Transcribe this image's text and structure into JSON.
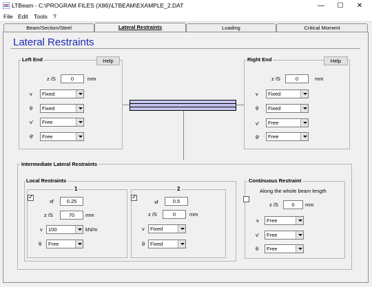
{
  "window": {
    "title": "LTBeam - C:\\PROGRAM FILES (X86)\\LTBEAM\\EXAMPLE_2.DAT",
    "minimize_label": "—",
    "maximize_label": "☐",
    "close_label": "✕"
  },
  "menu": {
    "file": "File",
    "edit": "Edit",
    "tools": "Tools",
    "help": "?"
  },
  "tabs": [
    {
      "label": "Beam/Section/Steel"
    },
    {
      "label": "Lateral Restraints"
    },
    {
      "label": "Loading"
    },
    {
      "label": "Critical Moment"
    }
  ],
  "page_title": "Lateral Restraints",
  "left_end": {
    "title": "Left End",
    "help": "Help",
    "zs_label": "z /S",
    "zs_value": "0",
    "zs_unit": "mm",
    "rows": [
      {
        "symbol": "v",
        "value": "Fixed"
      },
      {
        "symbol": "θ",
        "value": "Fixed"
      },
      {
        "symbol": "v'",
        "value": "Free"
      },
      {
        "symbol": "θ'",
        "value": "Free"
      }
    ]
  },
  "right_end": {
    "title": "Right End",
    "help": "Help",
    "zs_label": "z /S",
    "zs_value": "0",
    "zs_unit": "mm",
    "rows": [
      {
        "symbol": "v",
        "value": "Fixed"
      },
      {
        "symbol": "θ",
        "value": "Fixed"
      },
      {
        "symbol": "v'",
        "value": "Free"
      },
      {
        "symbol": "θ'",
        "value": "Free"
      }
    ]
  },
  "intermediate": {
    "title": "Intermediate Lateral Restraints",
    "local": {
      "title": "Local Restraints",
      "items": [
        {
          "number": "1",
          "checked": true,
          "xf_label": "xf",
          "xf_value": "0.25",
          "zs_label": "z /S",
          "zs_value": "70",
          "zs_unit": "mm",
          "v_symbol": "v",
          "v_value": "100",
          "v_unit": "kN/m",
          "theta_symbol": "θ",
          "theta_value": "Free"
        },
        {
          "number": "2",
          "checked": true,
          "xf_label": "xf",
          "xf_value": "0.5",
          "zs_label": "z /S",
          "zs_value": "0",
          "zs_unit": "mm",
          "v_symbol": "v",
          "v_value": "Fixed",
          "theta_symbol": "θ",
          "theta_value": "Fixed"
        }
      ]
    },
    "continuous": {
      "title": "Continuous Restraint",
      "checked": false,
      "subtitle": "Along the whole beam length",
      "zs_label": "z /S",
      "zs_value": "0",
      "zs_unit": "mm",
      "rows": [
        {
          "symbol": "v",
          "value": "Free"
        },
        {
          "symbol": "v'",
          "value": "Free"
        },
        {
          "symbol": "θ",
          "value": "Free"
        }
      ]
    }
  }
}
